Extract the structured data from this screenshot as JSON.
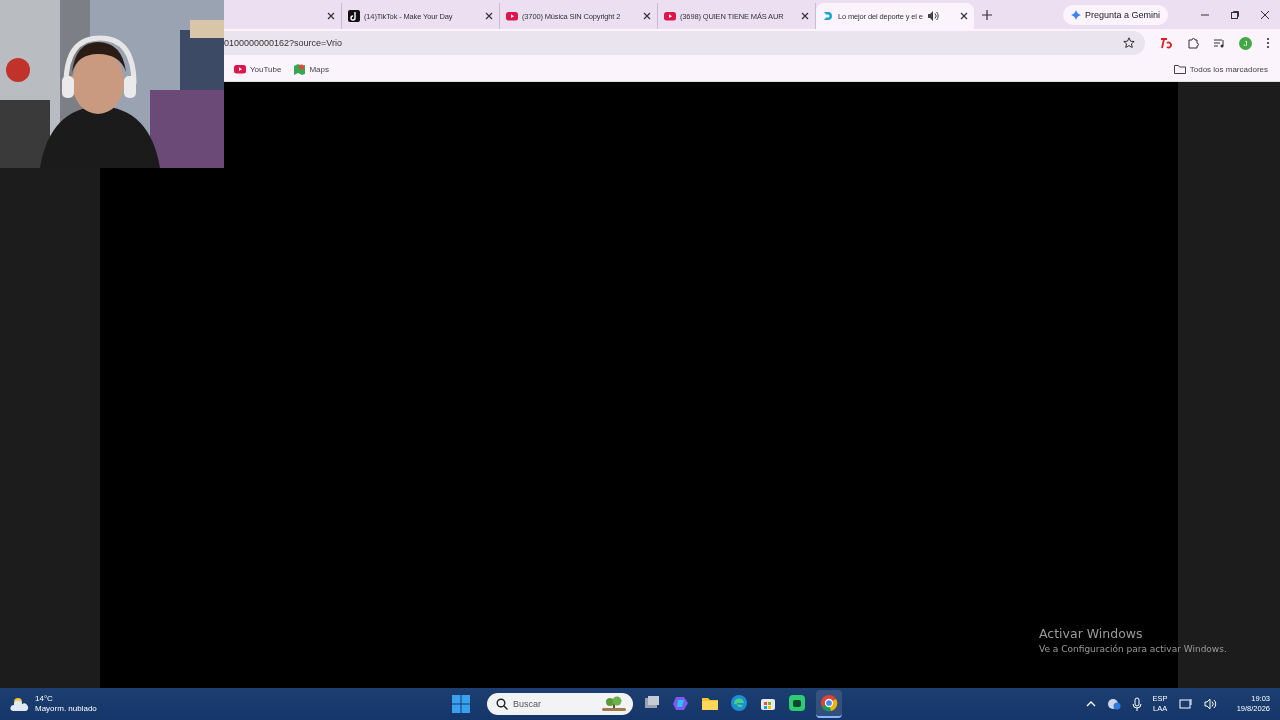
{
  "browser": {
    "tabs": [
      {
        "kind": "blank",
        "selected": false,
        "audio": false
      },
      {
        "title": "(14)TikTok - Make Your Day",
        "kind": "tiktok",
        "selected": false,
        "audio": false
      },
      {
        "title": "(3700) Música SIN Copyright 2",
        "kind": "youtube",
        "selected": false,
        "audio": false
      },
      {
        "title": "(3698) QUIEN TIENE MÁS AUR",
        "kind": "youtube",
        "selected": false,
        "audio": false
      },
      {
        "title": "Lo mejor del deporte y el e",
        "kind": "sport",
        "selected": true,
        "audio": true
      }
    ],
    "gemini_button": "Pregunta a Gemini",
    "address": "0100000000162?source=Vrio",
    "profile_initial": "J",
    "bookmarks": [
      {
        "label": "YouTube",
        "kind": "youtube"
      },
      {
        "label": "Maps",
        "kind": "maps"
      }
    ],
    "all_bookmarks": "Todos los marcadores"
  },
  "activation_notice": {
    "title": "Activar Windows",
    "subtitle": "Ve a Configuración para activar Windows."
  },
  "taskbar": {
    "weather": {
      "temperature": "14°C",
      "condition": "Mayorm. nublado"
    },
    "search_placeholder": "Buscar",
    "apps": [
      {
        "kind": "taskview",
        "selected": false
      },
      {
        "kind": "copilot",
        "selected": false
      },
      {
        "kind": "folder",
        "selected": false
      },
      {
        "kind": "edge",
        "selected": false
      },
      {
        "kind": "store",
        "selected": false
      },
      {
        "kind": "greenapp",
        "selected": false
      },
      {
        "kind": "chrome",
        "selected": true
      }
    ],
    "language": [
      "ESP",
      "LAA"
    ],
    "time": "19:03",
    "date": "19/8/2026"
  }
}
